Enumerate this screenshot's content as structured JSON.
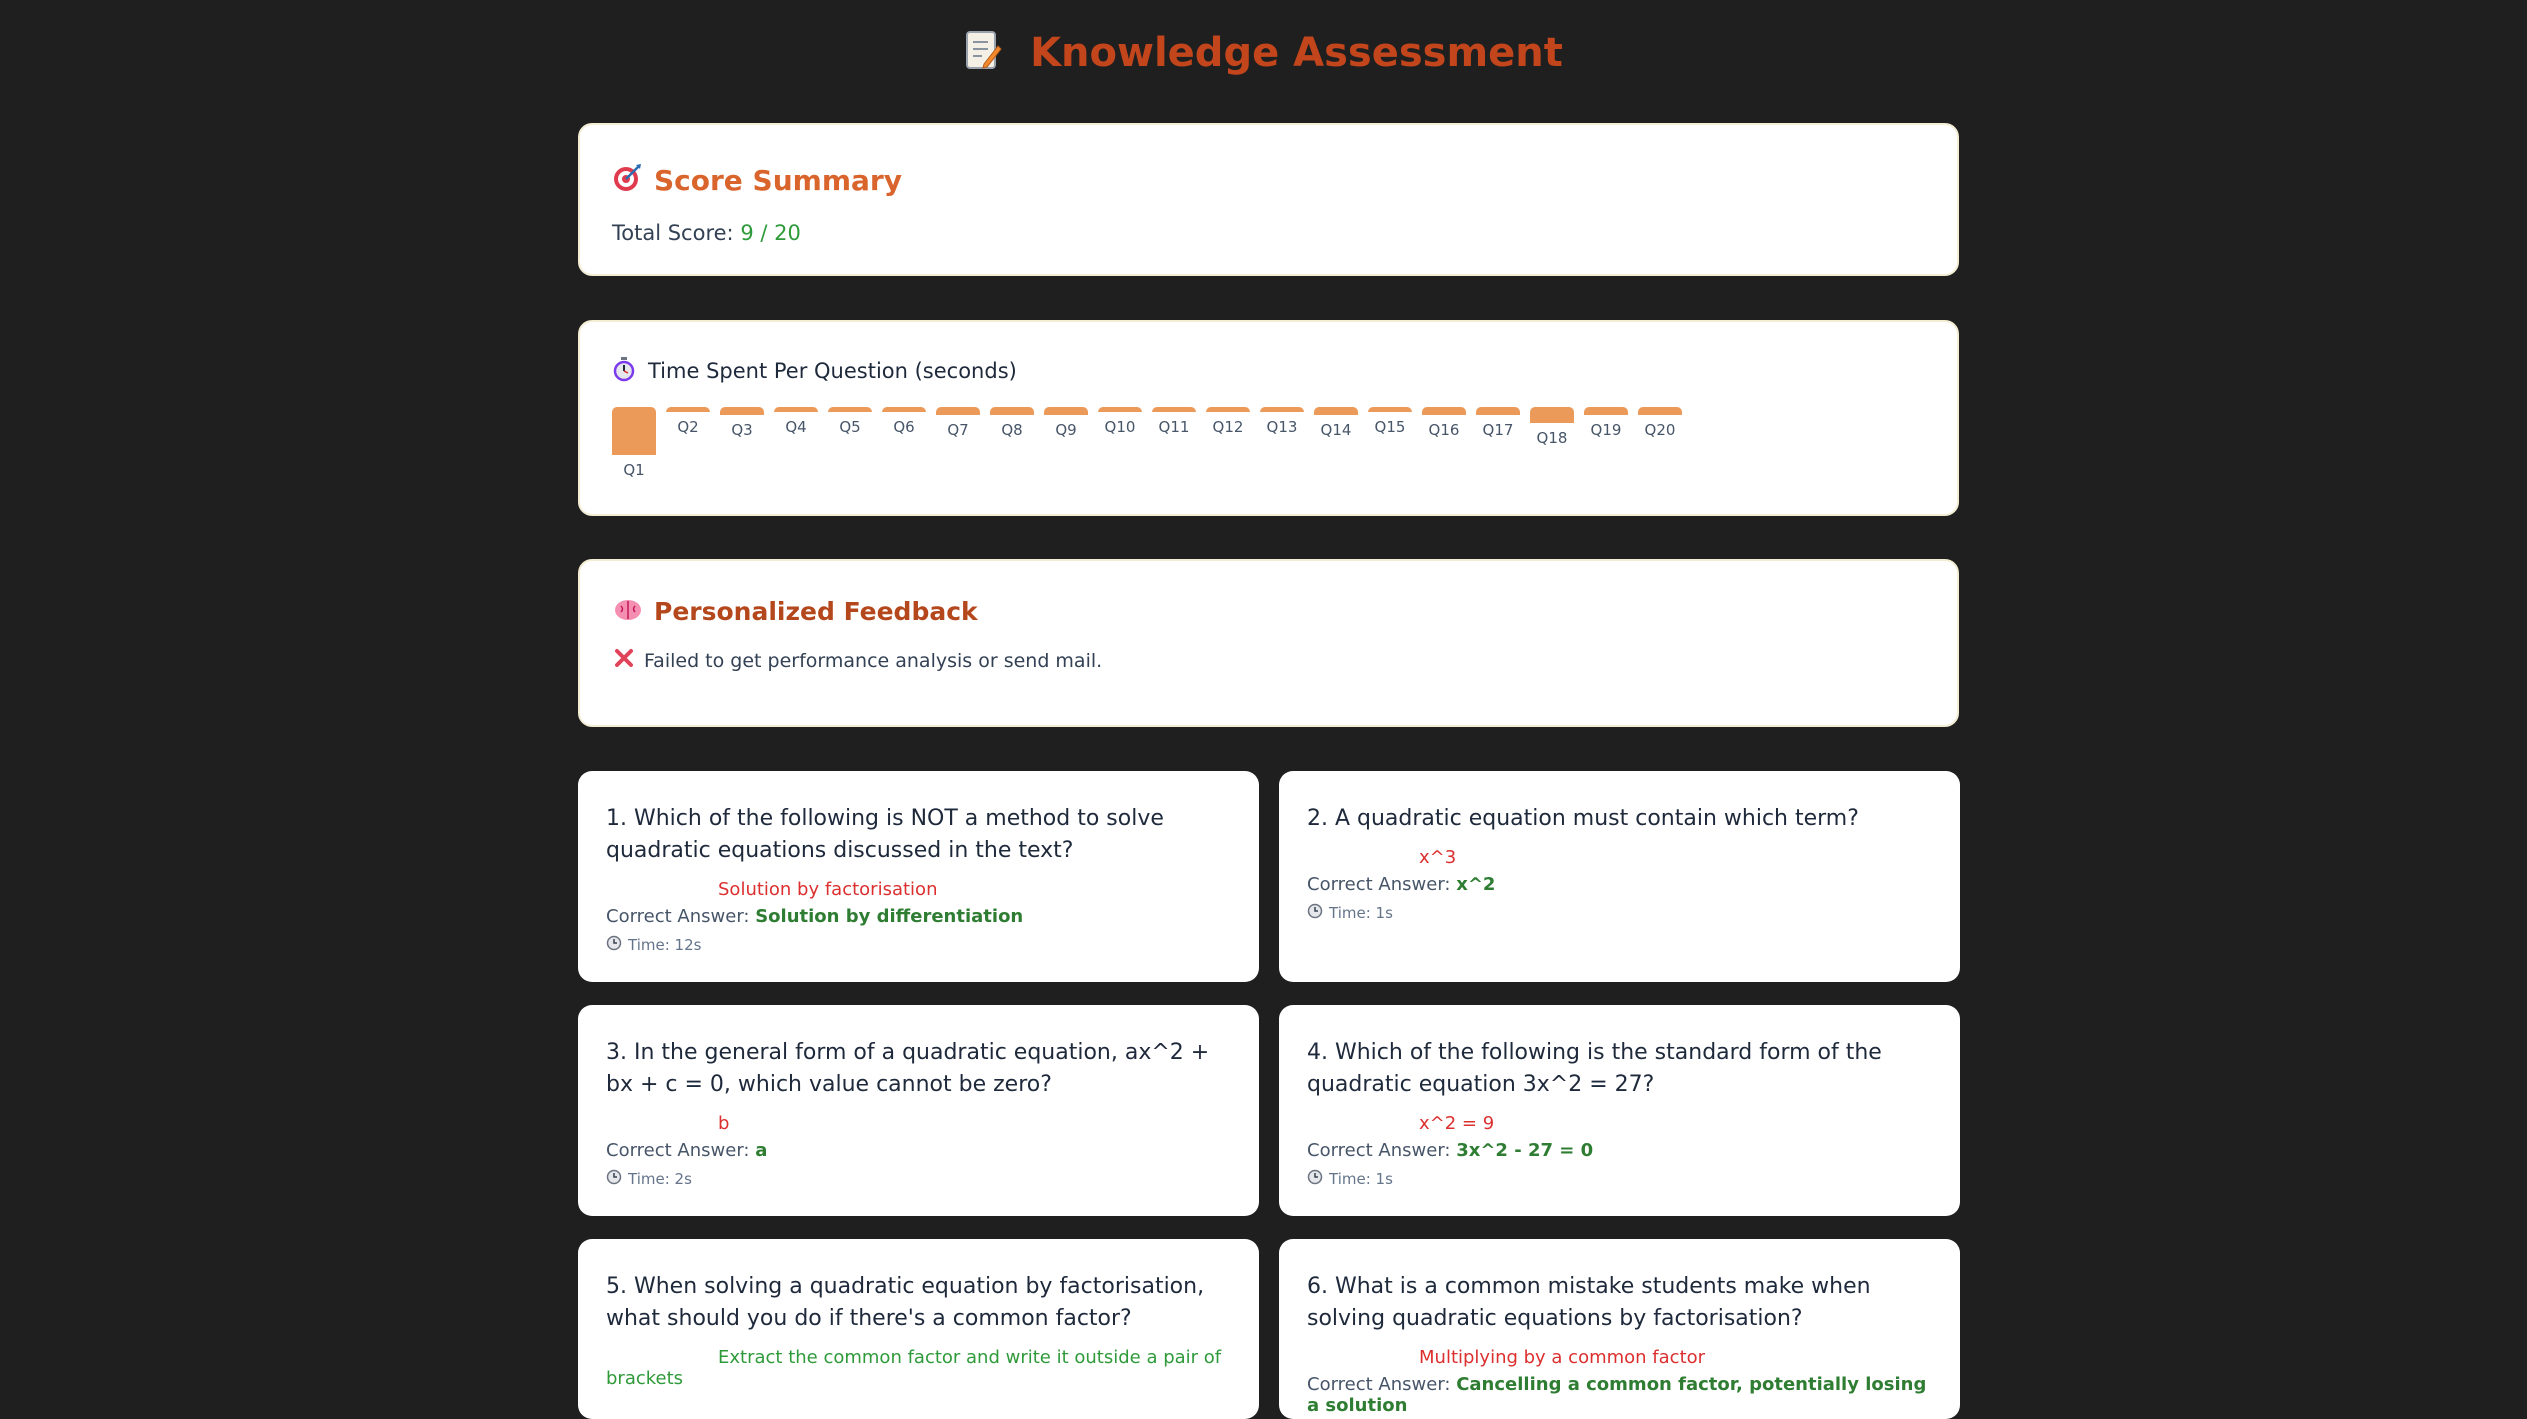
{
  "page": {
    "title": "Knowledge Assessment",
    "title_icon": "memo-icon",
    "accent": "#c2451c",
    "background": "#1f1f1f"
  },
  "score": {
    "heading": "Score Summary",
    "icon": "target-icon",
    "label": "Total Score:",
    "value": "9 / 20"
  },
  "timing": {
    "heading": "Time Spent Per Question (seconds)",
    "icon": "stopwatch-icon",
    "bar_color": "#ec9a5a",
    "questions": [
      {
        "label": "Q1",
        "seconds": 12
      },
      {
        "label": "Q2",
        "seconds": 1
      },
      {
        "label": "Q3",
        "seconds": 2
      },
      {
        "label": "Q4",
        "seconds": 1
      },
      {
        "label": "Q5",
        "seconds": 1
      },
      {
        "label": "Q6",
        "seconds": 1
      },
      {
        "label": "Q7",
        "seconds": 2
      },
      {
        "label": "Q8",
        "seconds": 2
      },
      {
        "label": "Q9",
        "seconds": 2
      },
      {
        "label": "Q10",
        "seconds": 1
      },
      {
        "label": "Q11",
        "seconds": 1
      },
      {
        "label": "Q12",
        "seconds": 1
      },
      {
        "label": "Q13",
        "seconds": 1
      },
      {
        "label": "Q14",
        "seconds": 2
      },
      {
        "label": "Q15",
        "seconds": 1
      },
      {
        "label": "Q16",
        "seconds": 2
      },
      {
        "label": "Q17",
        "seconds": 2
      },
      {
        "label": "Q18",
        "seconds": 4
      },
      {
        "label": "Q19",
        "seconds": 2
      },
      {
        "label": "Q20",
        "seconds": 2
      }
    ]
  },
  "feedback": {
    "heading": "Personalized Feedback",
    "icon": "brain-icon",
    "status_icon": "cross-mark-icon",
    "message": "Failed to get performance analysis or send mail."
  },
  "questions": [
    {
      "text": "1. Which of the following is NOT a method to solve quadratic equations discussed in the text?",
      "given": "Solution by factorisation",
      "given_correct": false,
      "correct_label": "Correct Answer:",
      "correct": "Solution by differentiation",
      "time": "Time: 12s"
    },
    {
      "text": "2. A quadratic equation must contain which term?",
      "given": "x^3",
      "given_correct": false,
      "correct_label": "Correct Answer:",
      "correct": "x^2",
      "time": "Time: 1s"
    },
    {
      "text": "3. In the general form of a quadratic equation, ax^2 + bx + c = 0, which value cannot be zero?",
      "given": "b",
      "given_correct": false,
      "correct_label": "Correct Answer:",
      "correct": "a",
      "time": "Time: 2s"
    },
    {
      "text": "4. Which of the following is the standard form of the quadratic equation 3x^2 = 27?",
      "given": "x^2 = 9",
      "given_correct": false,
      "correct_label": "Correct Answer:",
      "correct": "3x^2 - 27 = 0",
      "time": "Time: 1s"
    },
    {
      "text": "5. When solving a quadratic equation by factorisation, what should you do if there's a common factor?",
      "given": "Extract the common factor and write it outside a pair of brackets",
      "given_correct": true,
      "correct_label": "",
      "correct": "",
      "time": ""
    },
    {
      "text": "6. What is a common mistake students make when solving quadratic equations by factorisation?",
      "given": "Multiplying by a common factor",
      "given_correct": false,
      "correct_label": "Correct Answer:",
      "correct": "Cancelling a common factor, potentially losing a solution",
      "time": ""
    }
  ]
}
